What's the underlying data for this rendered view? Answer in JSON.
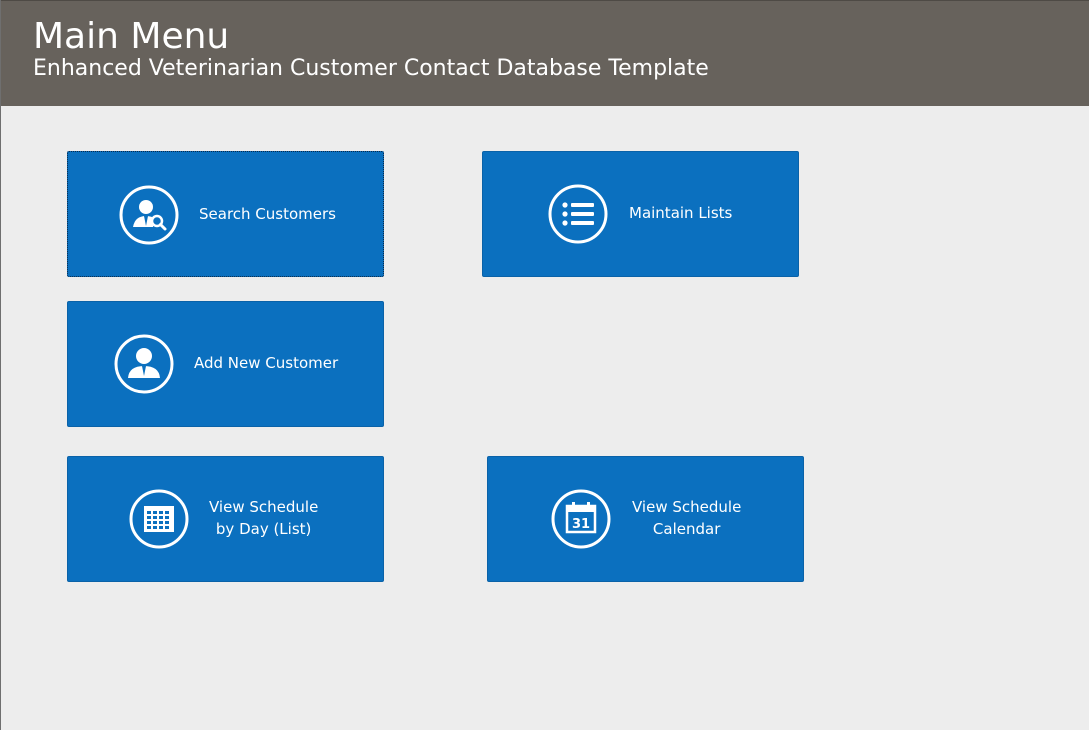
{
  "header": {
    "title": "Main Menu",
    "subtitle": "Enhanced Veterinarian Customer Contact Database Template"
  },
  "colors": {
    "header_bg": "#67625c",
    "page_bg": "#ededed",
    "tile_bg": "#0b70bf",
    "text_on_dark": "#ffffff"
  },
  "tiles": {
    "search_customers": {
      "label": "Search Customers",
      "icon": "user-search-icon"
    },
    "maintain_lists": {
      "label": "Maintain Lists",
      "icon": "list-icon"
    },
    "add_new_customer": {
      "label": "Add New Customer",
      "icon": "user-icon"
    },
    "view_schedule_day": {
      "label_line1": "View Schedule",
      "label_line2": "by Day (List)",
      "icon": "calendar-grid-icon"
    },
    "view_schedule_calendar": {
      "label_line1": "View Schedule",
      "label_line2": "Calendar",
      "icon": "calendar-31-icon"
    }
  }
}
